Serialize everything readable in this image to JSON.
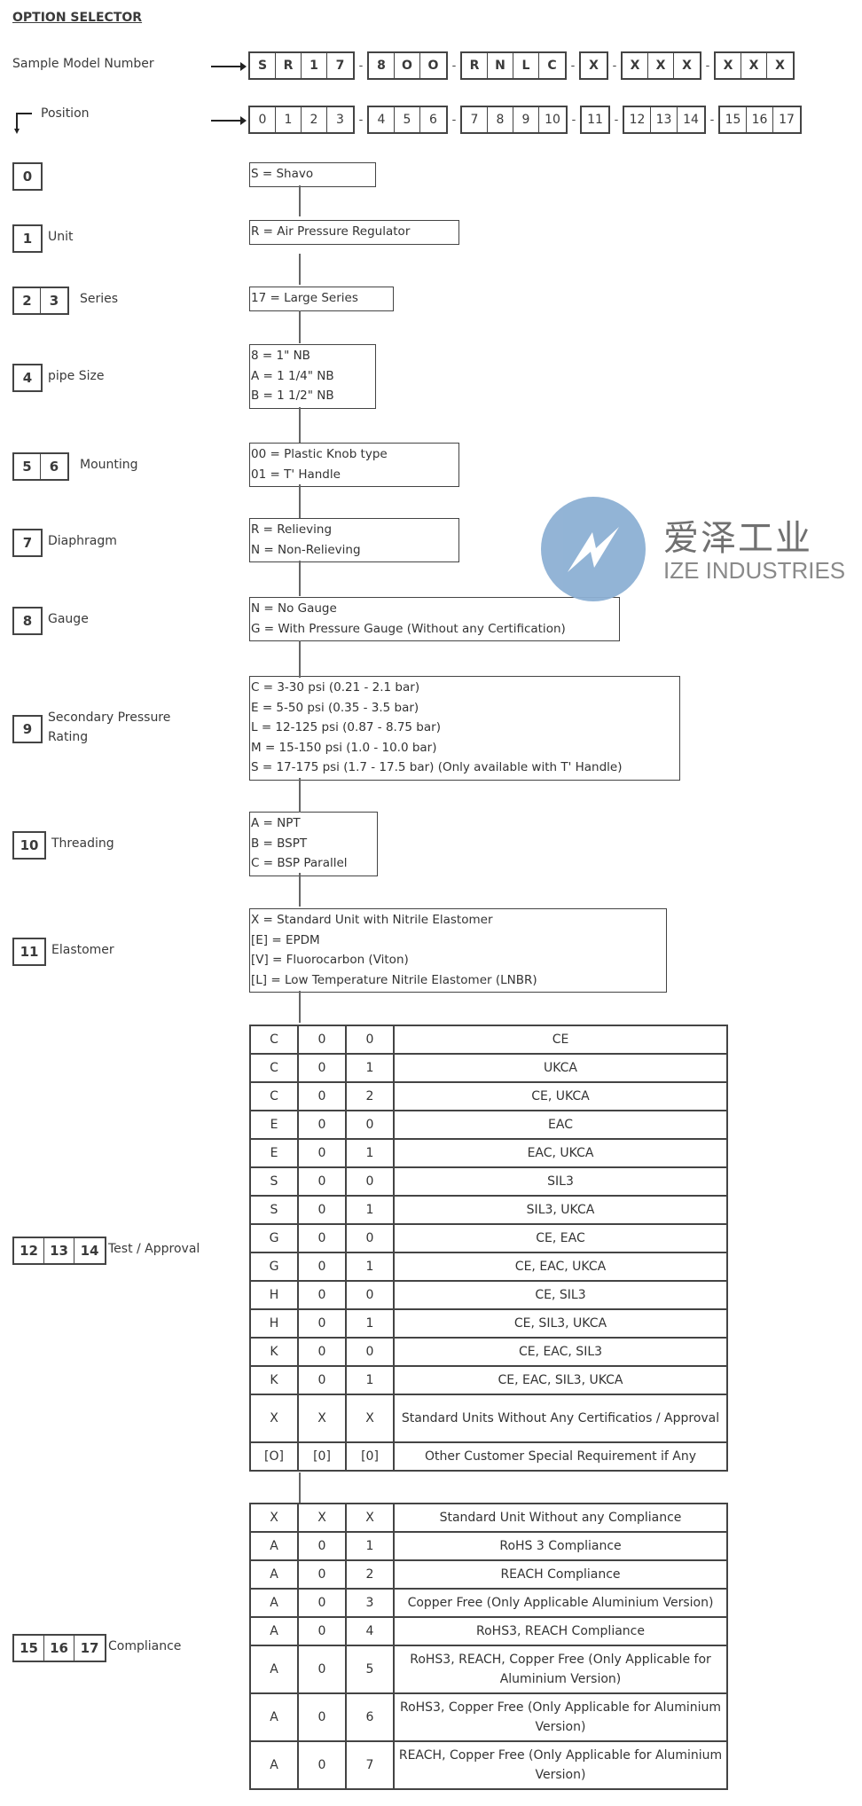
{
  "title": "OPTION SELECTOR",
  "sample_model": {
    "label": "Sample Model Number",
    "groups": [
      [
        "S",
        "R",
        "1",
        "7"
      ],
      [
        "8",
        "O",
        "O"
      ],
      [
        "R",
        "N",
        "L",
        "C"
      ],
      [
        "X"
      ],
      [
        "X",
        "X",
        "X"
      ],
      [
        "X",
        "X",
        "X"
      ]
    ]
  },
  "position": {
    "label": "Position",
    "groups": [
      [
        "0",
        "1",
        "2",
        "3"
      ],
      [
        "4",
        "5",
        "6"
      ],
      [
        "7",
        "8",
        "9",
        "10"
      ],
      [
        "11"
      ],
      [
        "12",
        "13",
        "14"
      ],
      [
        "15",
        "16",
        "17"
      ]
    ]
  },
  "separator": "-",
  "sections": [
    {
      "positions": [
        "0"
      ],
      "name": "",
      "options": [
        "S = Shavo"
      ]
    },
    {
      "positions": [
        "1"
      ],
      "name": "Unit",
      "options": [
        "R = Air Pressure Regulator"
      ]
    },
    {
      "positions": [
        "2",
        "3"
      ],
      "name": "Series",
      "options": [
        "17 = Large Series"
      ]
    },
    {
      "positions": [
        "4"
      ],
      "name": "pipe Size",
      "options": [
        "8 = 1\" NB",
        "A = 1 1/4\" NB",
        "B = 1 1/2\" NB"
      ]
    },
    {
      "positions": [
        "5",
        "6"
      ],
      "name": "Mounting",
      "options": [
        "00 = Plastic Knob type",
        "01 = T' Handle"
      ]
    },
    {
      "positions": [
        "7"
      ],
      "name": "Diaphragm",
      "options": [
        "R = Relieving",
        "N = Non-Relieving"
      ]
    },
    {
      "positions": [
        "8"
      ],
      "name": "Gauge",
      "options": [
        "N = No Gauge",
        "G = With Pressure Gauge (Without any Certification)"
      ]
    },
    {
      "positions": [
        "9"
      ],
      "name": "Secondary Pressure Rating",
      "options": [
        "C = 3-30 psi (0.21 - 2.1 bar)",
        "E = 5-50 psi (0.35 - 3.5 bar)",
        "L = 12-125 psi (0.87 - 8.75 bar)",
        "M = 15-150 psi (1.0 - 10.0 bar)",
        "S = 17-175 psi (1.7 - 17.5 bar) (Only available with T' Handle)"
      ]
    },
    {
      "positions": [
        "10"
      ],
      "name": "Threading",
      "options": [
        "A = NPT",
        "B = BSPT",
        "C = BSP Parallel"
      ]
    },
    {
      "positions": [
        "11"
      ],
      "name": "Elastomer",
      "options": [
        "X = Standard Unit with Nitrile Elastomer",
        "[E] = EPDM",
        "[V] = Fluorocarbon (Viton)",
        "[L] = Low Temperature Nitrile Elastomer (LNBR)"
      ]
    }
  ],
  "test_approval": {
    "positions": [
      "12",
      "13",
      "14"
    ],
    "name": "Test / Approval",
    "rows": [
      [
        "C",
        "0",
        "0",
        "CE"
      ],
      [
        "C",
        "0",
        "1",
        "UKCA"
      ],
      [
        "C",
        "0",
        "2",
        "CE, UKCA"
      ],
      [
        "E",
        "0",
        "0",
        "EAC"
      ],
      [
        "E",
        "0",
        "1",
        "EAC, UKCA"
      ],
      [
        "S",
        "0",
        "0",
        "SIL3"
      ],
      [
        "S",
        "0",
        "1",
        "SIL3, UKCA"
      ],
      [
        "G",
        "0",
        "0",
        "CE, EAC"
      ],
      [
        "G",
        "0",
        "1",
        "CE, EAC, UKCA"
      ],
      [
        "H",
        "0",
        "0",
        "CE, SIL3"
      ],
      [
        "H",
        "0",
        "1",
        "CE, SIL3, UKCA"
      ],
      [
        "K",
        "0",
        "0",
        "CE, EAC, SIL3"
      ],
      [
        "K",
        "0",
        "1",
        "CE, EAC, SIL3, UKCA"
      ],
      [
        "X",
        "X",
        "X",
        "Standard Units Without Any Certificatios / Approval"
      ],
      [
        "[O]",
        "[0]",
        "[0]",
        "Other Customer Special Requirement if Any"
      ]
    ]
  },
  "compliance": {
    "positions": [
      "15",
      "16",
      "17"
    ],
    "name": "Compliance",
    "rows": [
      [
        "X",
        "X",
        "X",
        "Standard Unit Without any Compliance"
      ],
      [
        "A",
        "0",
        "1",
        "RoHS 3 Compliance"
      ],
      [
        "A",
        "0",
        "2",
        "REACH Compliance"
      ],
      [
        "A",
        "0",
        "3",
        "Copper Free (Only Applicable Aluminium Version)"
      ],
      [
        "A",
        "0",
        "4",
        "RoHS3, REACH Compliance"
      ],
      [
        "A",
        "0",
        "5",
        "RoHS3, REACH, Copper Free (Only Applicable for Aluminium Version)"
      ],
      [
        "A",
        "0",
        "6",
        "RoHS3, Copper Free (Only Applicable for Aluminium Version)"
      ],
      [
        "A",
        "0",
        "7",
        "REACH, Copper Free (Only Applicable for Aluminium Version)"
      ]
    ]
  },
  "watermark": {
    "cn": "爱泽工业",
    "en": "IZE INDUSTRIES",
    "icon": "ize-logo-icon",
    "color": "#8db0d4"
  }
}
